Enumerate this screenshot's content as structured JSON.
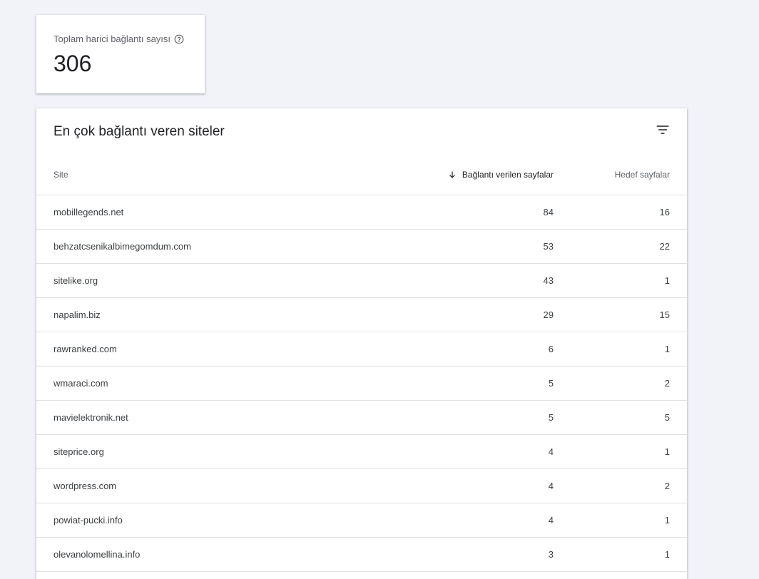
{
  "summary": {
    "label": "Toplam harici bağlantı sayısı",
    "value": "306"
  },
  "table": {
    "title": "En çok bağlantı veren siteler",
    "columns": {
      "site": "Site",
      "linking_pages": "Bağlantı verilen sayfalar",
      "target_pages": "Hedef sayfalar"
    },
    "sort": "linking_pages-desc",
    "rows": [
      {
        "site": "mobillegends.net",
        "linking": "84",
        "target": "16"
      },
      {
        "site": "behzatcsenikalbimegomdum.com",
        "linking": "53",
        "target": "22"
      },
      {
        "site": "sitelike.org",
        "linking": "43",
        "target": "1"
      },
      {
        "site": "napalim.biz",
        "linking": "29",
        "target": "15"
      },
      {
        "site": "rawranked.com",
        "linking": "6",
        "target": "1"
      },
      {
        "site": "wmaraci.com",
        "linking": "5",
        "target": "2"
      },
      {
        "site": "mavielektronik.net",
        "linking": "5",
        "target": "5"
      },
      {
        "site": "siteprice.org",
        "linking": "4",
        "target": "1"
      },
      {
        "site": "wordpress.com",
        "linking": "4",
        "target": "2"
      },
      {
        "site": "powiat-pucki.info",
        "linking": "4",
        "target": "1"
      },
      {
        "site": "olevanolomellina.info",
        "linking": "3",
        "target": "1"
      }
    ]
  }
}
